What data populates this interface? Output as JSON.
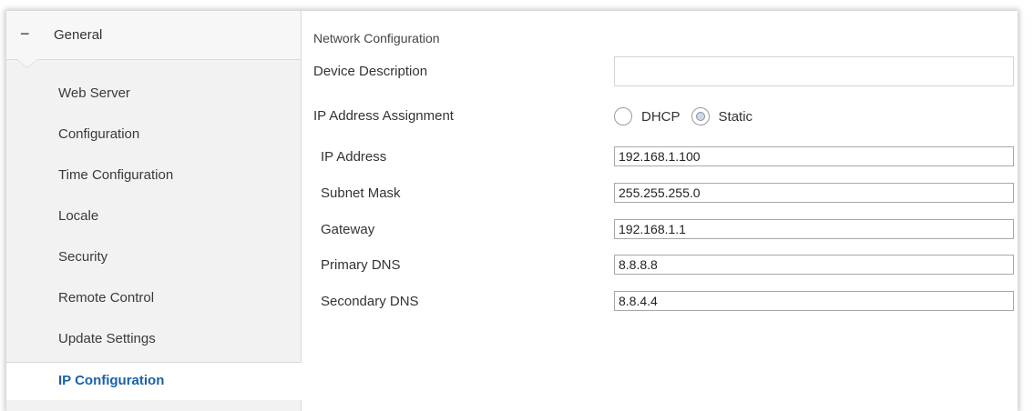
{
  "sidebar": {
    "group": {
      "label": "General",
      "icon": "minus-icon",
      "collapse_glyph": "−"
    },
    "items": [
      {
        "label": "Web Server",
        "active": false
      },
      {
        "label": "Configuration",
        "active": false
      },
      {
        "label": "Time Configuration",
        "active": false
      },
      {
        "label": "Locale",
        "active": false
      },
      {
        "label": "Security",
        "active": false
      },
      {
        "label": "Remote Control",
        "active": false
      },
      {
        "label": "Update Settings",
        "active": false
      },
      {
        "label": "IP Configuration",
        "active": true
      }
    ]
  },
  "main": {
    "section_title": "Network Configuration",
    "device_description": {
      "label": "Device Description",
      "value": ""
    },
    "ip_assignment": {
      "label": "IP Address Assignment",
      "options": [
        {
          "label": "DHCP",
          "checked": false
        },
        {
          "label": "Static",
          "checked": true
        }
      ]
    },
    "fields": [
      {
        "label": "IP Address",
        "value": "192.168.1.100"
      },
      {
        "label": "Subnet Mask",
        "value": "255.255.255.0"
      },
      {
        "label": "Gateway",
        "value": "192.168.1.1"
      },
      {
        "label": "Primary DNS",
        "value": "8.8.8.8"
      },
      {
        "label": "Secondary DNS",
        "value": "8.8.4.4"
      }
    ]
  },
  "colors": {
    "active_item": "#1a62a8",
    "sidebar_bg": "#f2f2f2",
    "main_bg": "#ffffff"
  }
}
